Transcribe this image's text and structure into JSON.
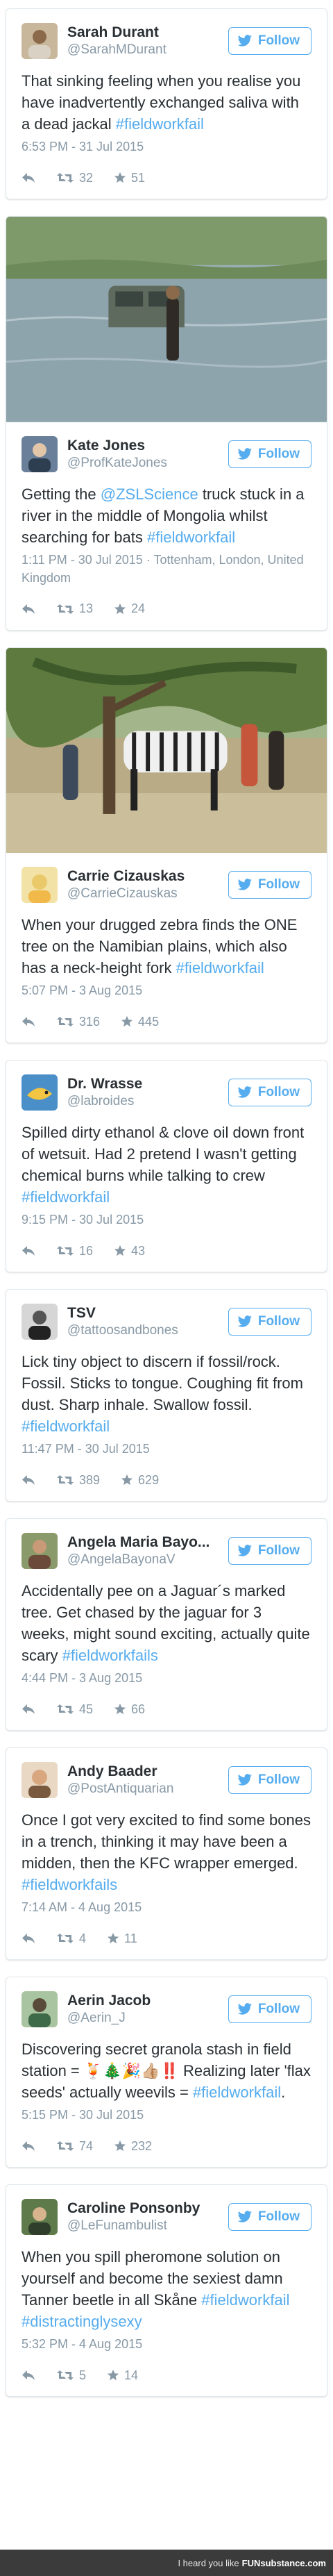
{
  "colors": {
    "accent": "#55acee",
    "text": "#292f33",
    "muted": "#8899a6",
    "border": "#e1e8ed"
  },
  "follow_label": "Follow",
  "tweets": [
    {
      "name": "Sarah Durant",
      "handle": "@SarahMDurant",
      "parts": [
        {
          "t": "That sinking feeling when you realise you have inadvertently exchanged saliva with a dead jackal ",
          "hl": false
        },
        {
          "t": "#fieldworkfail",
          "hl": true
        }
      ],
      "meta": "6:53 PM - 31 Jul 2015",
      "retweets": "32",
      "likes": "51"
    },
    {
      "name": "Kate Jones",
      "handle": "@ProfKateJones",
      "parts": [
        {
          "t": "Getting the ",
          "hl": false
        },
        {
          "t": "@ZSLScience",
          "hl": true
        },
        {
          "t": " truck stuck in a river in the middle of Mongolia whilst searching for bats ",
          "hl": false
        },
        {
          "t": "#fieldworkfail",
          "hl": true
        }
      ],
      "meta": "1:11 PM - 30 Jul 2015 · Tottenham, London, United Kingdom",
      "retweets": "13",
      "likes": "24"
    },
    {
      "name": "Carrie Cizauskas",
      "handle": "@CarrieCizauskas",
      "parts": [
        {
          "t": "When your drugged zebra finds the ONE tree on the Namibian plains, which also has a neck-height fork ",
          "hl": false
        },
        {
          "t": "#fieldworkfail",
          "hl": true
        }
      ],
      "meta": "5:07 PM - 3 Aug 2015",
      "retweets": "316",
      "likes": "445"
    },
    {
      "name": "Dr. Wrasse",
      "handle": "@labroides",
      "parts": [
        {
          "t": "Spilled dirty ethanol & clove oil down front of wetsuit. Had 2 pretend I wasn't getting chemical burns while talking to crew ",
          "hl": false
        },
        {
          "t": "#fieldworkfail",
          "hl": true
        }
      ],
      "meta": "9:15 PM - 30 Jul 2015",
      "retweets": "16",
      "likes": "43"
    },
    {
      "name": "TSV",
      "handle": "@tattoosandbones",
      "parts": [
        {
          "t": "Lick tiny object to discern if fossil/rock. Fossil. Sticks to tongue. Coughing fit from dust. Sharp inhale. Swallow fossil. ",
          "hl": false
        },
        {
          "t": "#fieldworkfail",
          "hl": true
        }
      ],
      "meta": "11:47 PM - 30 Jul 2015",
      "retweets": "389",
      "likes": "629"
    },
    {
      "name": "Angela Maria Bayo...",
      "handle": "@AngelaBayonaV",
      "parts": [
        {
          "t": "Accidentally pee on a Jaguar´s marked tree. Get chased by the jaguar for 3 weeks, might sound exciting, actually quite scary ",
          "hl": false
        },
        {
          "t": "#fieldworkfails",
          "hl": true
        }
      ],
      "meta": "4:44 PM - 3 Aug 2015",
      "retweets": "45",
      "likes": "66"
    },
    {
      "name": "Andy Baader",
      "handle": "@PostAntiquarian",
      "parts": [
        {
          "t": "Once I got very excited to find some bones in a trench, thinking it may have been a midden, then the KFC wrapper emerged. ",
          "hl": false
        },
        {
          "t": "#fieldworkfails",
          "hl": true
        }
      ],
      "meta": "7:14 AM - 4 Aug 2015",
      "retweets": "4",
      "likes": "11"
    },
    {
      "name": "Aerin Jacob",
      "handle": "@Aerin_J",
      "parts": [
        {
          "t": "Discovering secret granola stash in field station = 🍹🎄🎉👍🏼‼️ Realizing later 'flax seeds' actually weevils = ",
          "hl": false
        },
        {
          "t": "#fieldworkfail",
          "hl": true
        },
        {
          "t": ".",
          "hl": false
        }
      ],
      "meta": "5:15 PM - 30 Jul 2015",
      "retweets": "74",
      "likes": "232"
    },
    {
      "name": "Caroline Ponsonby",
      "handle": "@LeFunambulist",
      "parts": [
        {
          "t": "When you spill pheromone solution on yourself and become the sexiest damn Tanner beetle in all Skåne ",
          "hl": false
        },
        {
          "t": "#fieldworkfail",
          "hl": true
        },
        {
          "t": " ",
          "hl": false
        },
        {
          "t": "#distractinglysexy",
          "hl": true
        }
      ],
      "meta": "5:32 PM - 4 Aug 2015",
      "retweets": "5",
      "likes": "14"
    }
  ],
  "footer": {
    "prefix": "I heard you like",
    "brand": "FUNsubstance.com"
  }
}
